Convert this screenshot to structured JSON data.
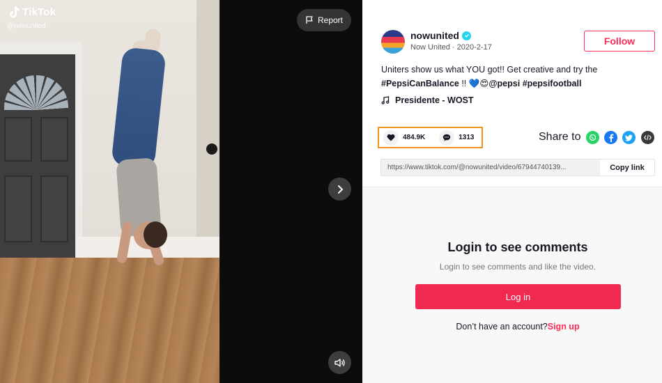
{
  "app": {
    "logo_text": "TikTok",
    "handle": "@nowunited"
  },
  "video": {
    "report_label": "Report",
    "next_icon": "chevron-right-icon",
    "sound_icon": "speaker-icon"
  },
  "author": {
    "name": "nowunited",
    "display_name": "Now United",
    "date": "2020-2-17",
    "verified": true
  },
  "follow_label": "Follow",
  "caption": {
    "text_1": "Uniters show us what YOU got!! Get creative and try the",
    "hashtag_1": "#PepsiCanBalance",
    "mid": " !! 💙😍",
    "mention": "@pepsi",
    "hashtag_2": "#pepsifootball"
  },
  "music": {
    "title": "Presidente - WOST"
  },
  "stats": {
    "likes": "484.9K",
    "comments": "1313"
  },
  "share": {
    "label": "Share to",
    "targets": [
      "whatsapp-icon",
      "facebook-icon",
      "twitter-icon",
      "embed-icon"
    ]
  },
  "link": {
    "url": "https://www.tiktok.com/@nowunited/video/67944740139...",
    "copy_label": "Copy link"
  },
  "comments": {
    "title": "Login to see comments",
    "subtitle": "Login to see comments and like the video.",
    "login_label": "Log in",
    "no_account": "Don’t have an account?",
    "signup_label": "Sign up"
  },
  "colors": {
    "accent": "#fe2c55",
    "highlight_border": "#f2941c"
  }
}
